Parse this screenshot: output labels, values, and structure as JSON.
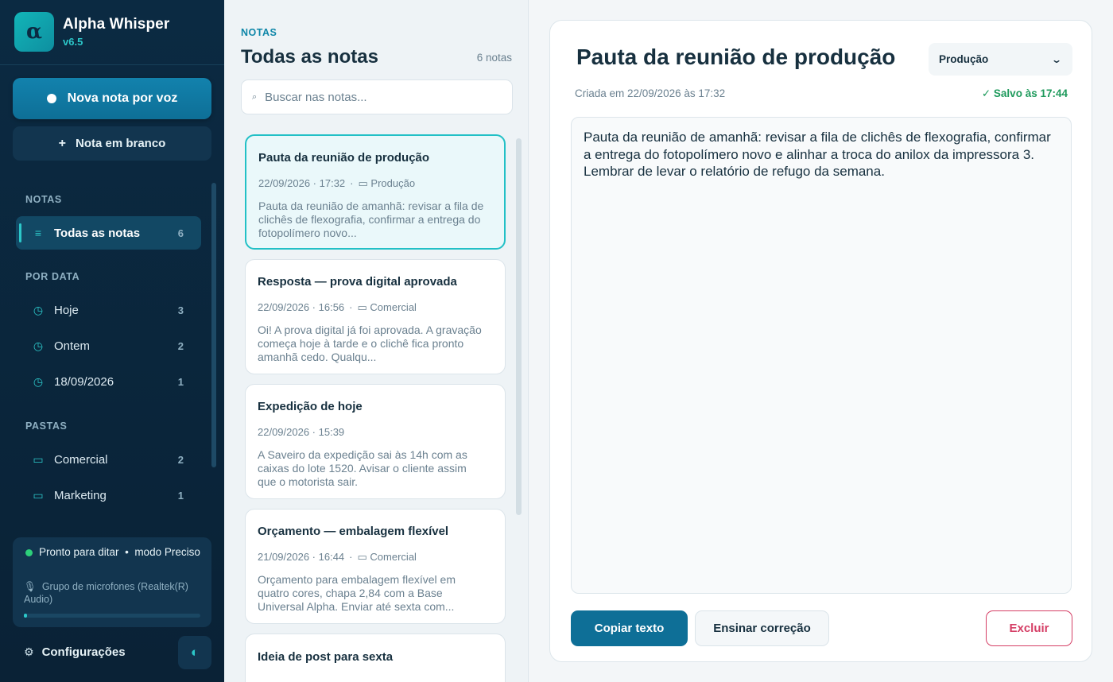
{
  "app": {
    "name": "Alpha Whisper",
    "version": "v6.5",
    "logo_glyph": "α",
    "accent_color": "#2cc7c9",
    "sidebar_bg": "#0b2a42"
  },
  "sidebar": {
    "new_voice_note": "Nova nota por voz",
    "new_blank_note": "Nota em branco",
    "sections": {
      "notes": "NOTAS",
      "by_date": "POR DATA",
      "folders": "PASTAS"
    },
    "notes_items": [
      {
        "label": "Todas as notas",
        "count": "6",
        "icon": "list-icon",
        "active": true
      }
    ],
    "date_items": [
      {
        "label": "Hoje",
        "count": "3",
        "icon": "clock-icon"
      },
      {
        "label": "Ontem",
        "count": "2",
        "icon": "clock-icon"
      },
      {
        "label": "18/09/2026",
        "count": "1",
        "icon": "clock-icon"
      }
    ],
    "folder_items": [
      {
        "label": "Comercial",
        "count": "2",
        "icon": "folder-icon"
      },
      {
        "label": "Marketing",
        "count": "1",
        "icon": "folder-icon"
      }
    ],
    "status": {
      "ready": "Pronto para ditar",
      "mode": "modo Preciso",
      "microphone": "Grupo de microfones (Realtek(R) Audio)",
      "level_fraction": 0.02,
      "ok_color": "#2dd07a"
    },
    "settings_label": "Configurações"
  },
  "list": {
    "eyebrow": "NOTAS",
    "title": "Todas as notas",
    "count_label": "6 notas",
    "search_placeholder": "Buscar nas notas...",
    "notes": [
      {
        "title": "Pauta da reunião de produção",
        "datetime": "22/09/2026 · 17:32",
        "folder": "Produção",
        "preview": "Pauta da reunião de amanhã: revisar a fila de clichês de flexografia, confirmar a entrega do fotopolímero novo...",
        "selected": true
      },
      {
        "title": "Resposta — prova digital aprovada",
        "datetime": "22/09/2026 · 16:56",
        "folder": "Comercial",
        "preview": "Oi! A prova digital já foi aprovada. A gravação começa hoje à tarde e o clichê fica pronto amanhã cedo. Qualqu..."
      },
      {
        "title": "Expedição de hoje",
        "datetime": "22/09/2026 · 15:39",
        "folder": "",
        "preview": "A Saveiro da expedição sai às 14h com as caixas do lote 1520. Avisar o cliente assim que o motorista sair."
      },
      {
        "title": "Orçamento — embalagem flexível",
        "datetime": "21/09/2026 · 16:44",
        "folder": "Comercial",
        "preview": "Orçamento para embalagem flexível em quatro cores, chapa 2,84 com a Base Universal Alpha. Enviar até sexta com..."
      },
      {
        "title": "Ideia de post para sexta",
        "datetime": "",
        "folder": "",
        "preview": ""
      }
    ]
  },
  "editor": {
    "title": "Pauta da reunião de produção",
    "folder_selected": "Produção",
    "created": "Criada em 22/09/2026 às 17:32",
    "saved": "✓ Salvo às 17:44",
    "body": "Pauta da reunião de amanhã: revisar a fila de clichês de flexografia, confirmar a entrega do fotopolímero novo e alinhar a troca do anilox da impressora 3. Lembrar de levar o relatório de refugo da semana.",
    "copy_button": "Copiar texto",
    "teach_button": "Ensinar correção",
    "delete_button": "Excluir",
    "saved_color": "#1e9a5c",
    "delete_color": "#d53f66"
  }
}
